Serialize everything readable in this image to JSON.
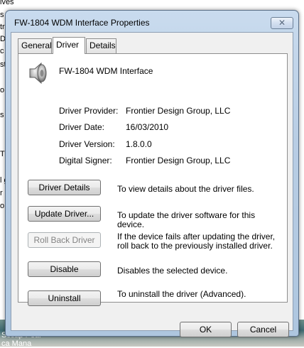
{
  "background": {
    "fragments": [
      "ives",
      "s",
      "tr",
      "D",
      "c",
      "st",
      "o",
      "s",
      "T",
      "l g",
      "r",
      "o"
    ],
    "bottom_fragments": [
      "Sccap Pear",
      "ca Mana"
    ]
  },
  "window": {
    "title": "FW-1804 WDM Interface Properties",
    "close_glyph": "✕"
  },
  "tabs": [
    {
      "label": "General"
    },
    {
      "label": "Driver"
    },
    {
      "label": "Details"
    }
  ],
  "device": {
    "name": "FW-1804 WDM Interface",
    "icon": "speaker-icon"
  },
  "info": {
    "provider_label": "Driver Provider:",
    "provider_value": "Frontier Design Group, LLC",
    "date_label": "Driver Date:",
    "date_value": "16/03/2010",
    "version_label": "Driver Version:",
    "version_value": "1.8.0.0",
    "signer_label": "Digital Signer:",
    "signer_value": "Frontier Design Group, LLC"
  },
  "actions": {
    "details_label": "Driver Details",
    "details_desc": "To view details about the driver files.",
    "update_label": "Update Driver...",
    "update_desc": "To update the driver software for this device.",
    "rollback_label": "Roll Back Driver",
    "rollback_desc": "If the device fails after updating the driver, roll back to the previously installed driver.",
    "disable_label": "Disable",
    "disable_desc": "Disables the selected device.",
    "uninstall_label": "Uninstall",
    "uninstall_desc": "To uninstall the driver (Advanced)."
  },
  "footer": {
    "ok_label": "OK",
    "cancel_label": "Cancel"
  }
}
